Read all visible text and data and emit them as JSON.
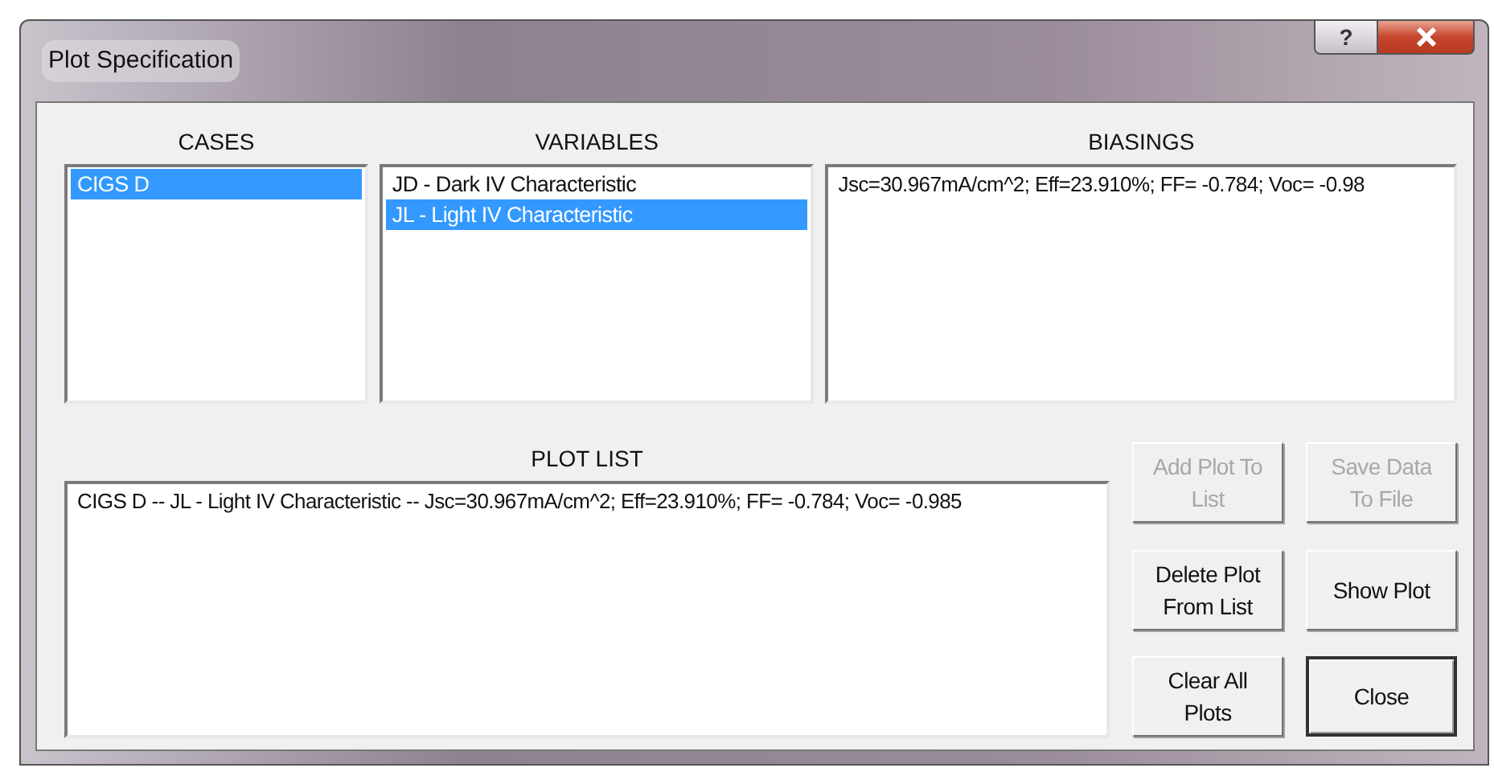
{
  "window": {
    "title": "Plot Specification",
    "help_label": "?"
  },
  "cases": {
    "heading": "CASES",
    "items": [
      {
        "label": "CIGS D",
        "selected": true
      }
    ]
  },
  "variables": {
    "heading": "VARIABLES",
    "items": [
      {
        "label": "JD - Dark IV Characteristic",
        "selected": false
      },
      {
        "label": "JL - Light IV Characteristic",
        "selected": true
      }
    ]
  },
  "biasings": {
    "heading": "BIASINGS",
    "items": [
      {
        "label": "Jsc=30.967mA/cm^2; Eff=23.910%; FF= -0.784; Voc= -0.98",
        "selected": false
      }
    ]
  },
  "plot_list": {
    "heading": "PLOT LIST",
    "items": [
      {
        "label": "CIGS D -- JL - Light IV Characteristic -- Jsc=30.967mA/cm^2; Eff=23.910%; FF= -0.784; Voc= -0.985",
        "selected": false
      }
    ]
  },
  "buttons": [
    {
      "label": "Add Plot To List",
      "disabled": true,
      "default": false
    },
    {
      "label": "Save Data To File",
      "disabled": true,
      "default": false
    },
    {
      "label": "Delete Plot From List",
      "disabled": false,
      "default": false
    },
    {
      "label": "Show Plot",
      "disabled": false,
      "default": false
    },
    {
      "label": "Clear All Plots",
      "disabled": false,
      "default": false
    },
    {
      "label": "Close",
      "disabled": false,
      "default": true
    }
  ]
}
